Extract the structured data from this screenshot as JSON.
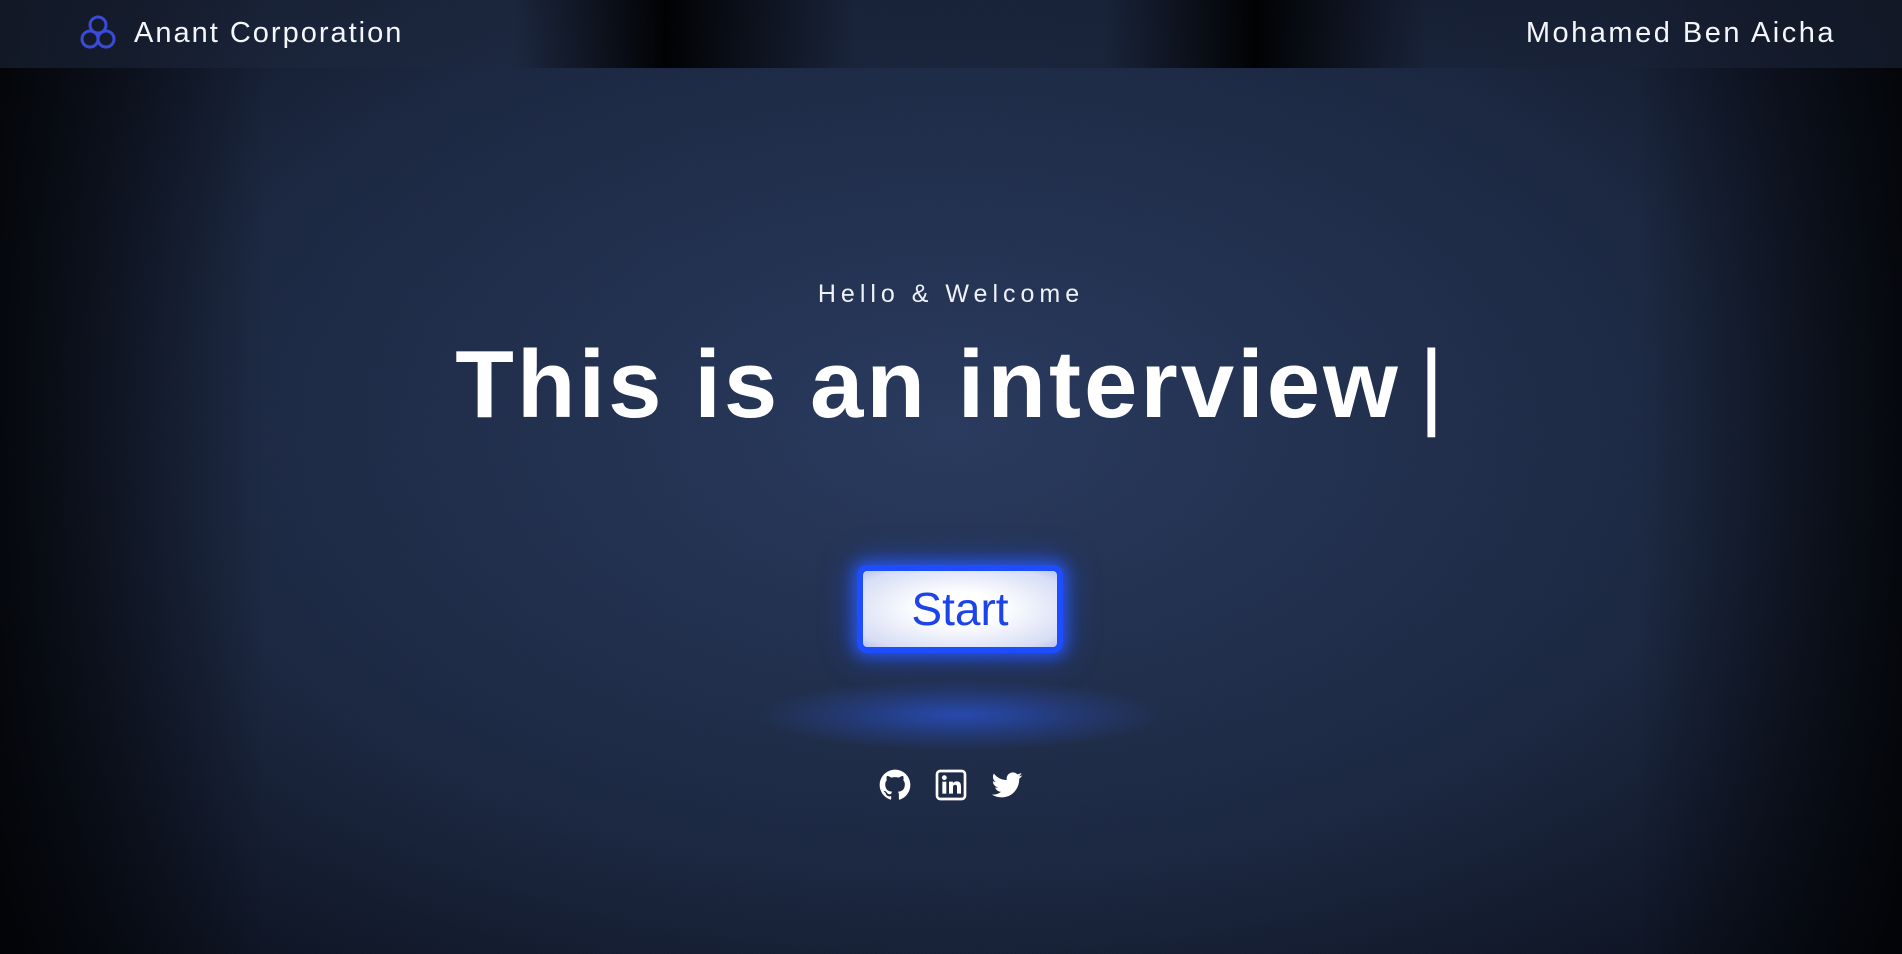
{
  "header": {
    "brand_name": "Anant Corporation",
    "user_name": "Mohamed Ben Aicha",
    "logo_icon": "triquetra-icon"
  },
  "hero": {
    "greeting": "Hello & Welcome",
    "headline": "This is an interview",
    "cursor": "|"
  },
  "cta": {
    "start_label": "Start"
  },
  "socials": [
    {
      "icon": "github-icon"
    },
    {
      "icon": "linkedin-icon"
    },
    {
      "icon": "twitter-icon"
    }
  ],
  "colors": {
    "accent": "#1e4cff",
    "button_text": "#1d44e8",
    "logo": "#3a4bd8",
    "background": "#1b2740",
    "text": "#ffffff"
  }
}
